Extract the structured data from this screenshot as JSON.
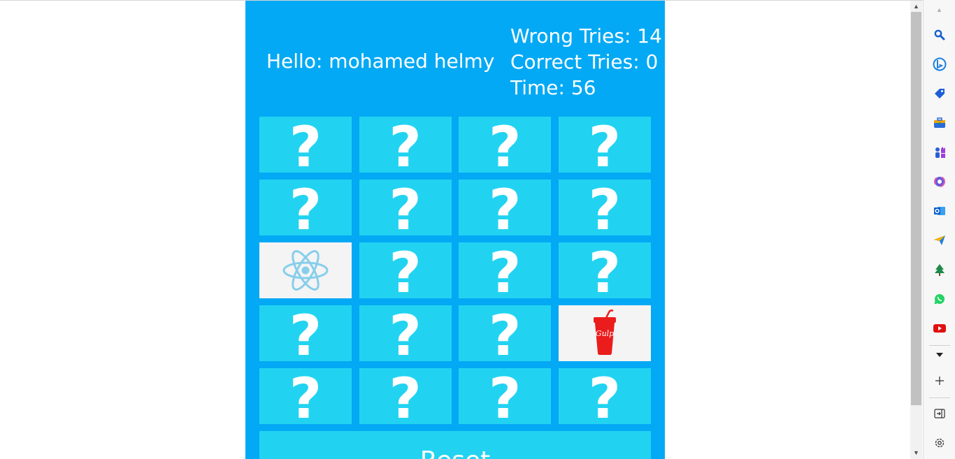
{
  "game": {
    "greeting": "Hello: mohamed helmy",
    "wrong_tries": "Wrong Tries: 14",
    "correct_tries": "Correct Tries: 0",
    "time": "Time: 56",
    "hidden_symbol": "?",
    "reset_label": "Reset"
  },
  "cards": [
    "hidden",
    "hidden",
    "hidden",
    "hidden",
    "hidden",
    "hidden",
    "hidden",
    "hidden",
    "react",
    "hidden",
    "hidden",
    "hidden",
    "hidden",
    "hidden",
    "hidden",
    "gulp",
    "hidden",
    "hidden",
    "hidden",
    "hidden"
  ],
  "gulp_logo_text": "Gulp",
  "colors": {
    "background": "#03a9f4",
    "card": "#22d3f1",
    "flipped_card": "#f4f4f4",
    "react": "#87ceeb",
    "gulp": "#eb1c1c"
  },
  "sidebar_icons": [
    "search-icon",
    "bing-icon",
    "shopping-tag-icon",
    "toolbox-icon",
    "games-icon",
    "copilot-icon",
    "outlook-icon",
    "send-icon",
    "tree-icon",
    "whatsapp-icon",
    "youtube-icon",
    "chevron-down-icon",
    "add-icon",
    "hide-sidebar-icon",
    "settings-icon"
  ]
}
